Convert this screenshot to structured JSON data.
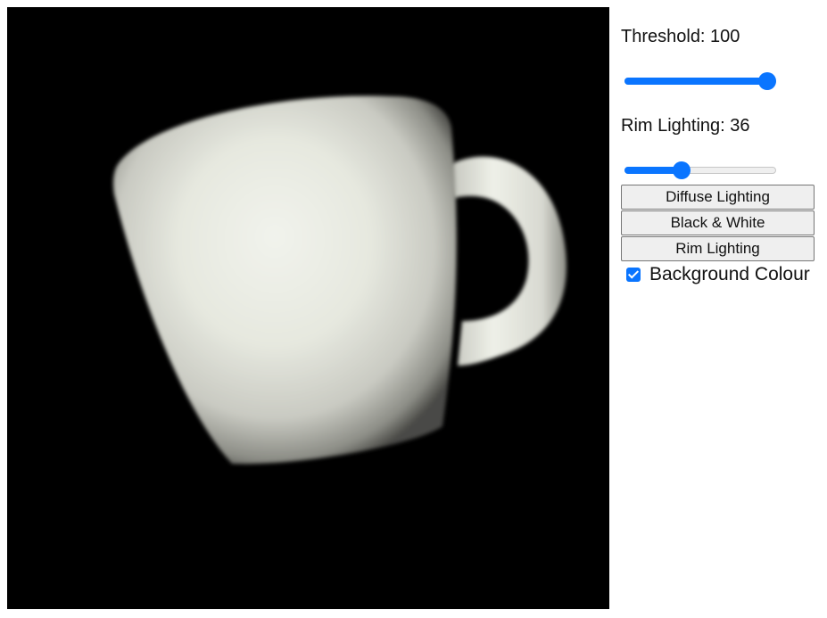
{
  "controls": {
    "threshold": {
      "label_text": "Threshold: 100",
      "value": 100,
      "min": 0,
      "max": 100
    },
    "rim_lighting": {
      "label_text": "Rim Lighting: 36",
      "value": 36,
      "min": 0,
      "max": 100
    },
    "buttons": {
      "diffuse": "Diffuse Lighting",
      "black_white": "Black & White",
      "rim": "Rim Lighting"
    },
    "background_colour": {
      "label": "Background Colour",
      "checked": true
    }
  },
  "scene": {
    "object": "mug",
    "background_color": "#000000",
    "object_color": "#eef0e8",
    "accent_color": "#0a75ff"
  }
}
